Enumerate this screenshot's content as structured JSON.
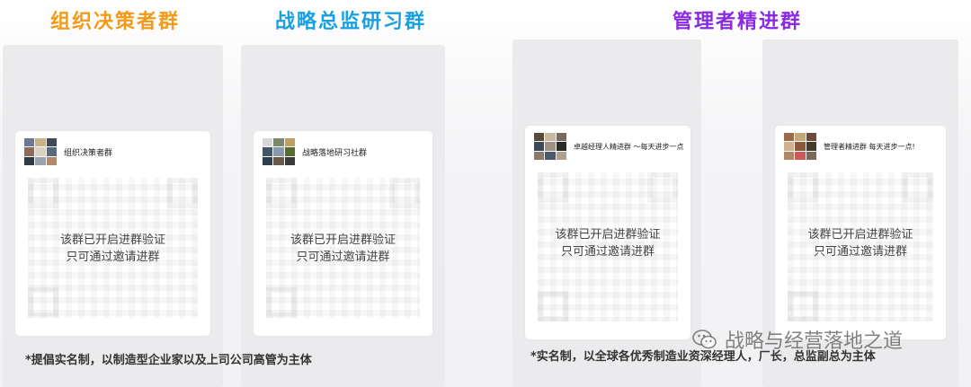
{
  "headings": {
    "org": {
      "text": "组织决策者群",
      "color": "#f39a1a"
    },
    "strategy": {
      "text": "战略总监研习群",
      "color": "#1aa0e0"
    },
    "mgmt": {
      "text": "管理者精进群",
      "color": "#8a2be2"
    }
  },
  "cards": [
    {
      "group_name": "组织决策者群",
      "avatar_icon": "group-avatar-icon"
    },
    {
      "group_name": "战略落地研习社群",
      "avatar_icon": "group-avatar-icon"
    },
    {
      "group_name": "卓越经理人精进群 ～每天进步一点",
      "avatar_icon": "group-avatar-icon"
    },
    {
      "group_name": "管理者精进群 每天进步一点!",
      "avatar_icon": "group-avatar-icon"
    }
  ],
  "verify_line1": "该群已开启进群验证",
  "verify_line2": "只可通过邀请进群",
  "footnotes": {
    "left": "*提倡实名制，以制造型企业家以及上司公司高管为主体",
    "right": "*实名制，以全球各优秀制造业资深经理人，厂长，总监副总为主体"
  },
  "watermark": {
    "text": "战略与经营落地之道",
    "icon": "wechat-icon"
  }
}
